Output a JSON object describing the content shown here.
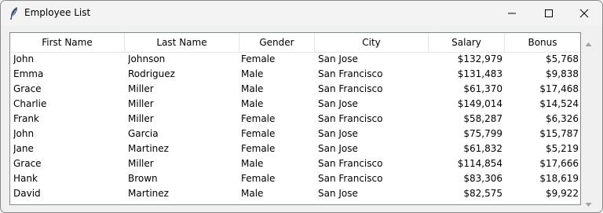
{
  "window": {
    "title": "Employee List",
    "icon": "feather-icon"
  },
  "controls": {
    "minimize_icon": "minimize-icon",
    "maximize_icon": "maximize-icon",
    "close_icon": "close-icon"
  },
  "table": {
    "columns": [
      "First Name",
      "Last Name",
      "Gender",
      "City",
      "Salary",
      "Bonus"
    ],
    "rows": [
      [
        "John",
        "Johnson",
        "Female",
        "San Jose",
        "$132,979",
        "$5,768"
      ],
      [
        "Emma",
        "Rodriguez",
        "Male",
        "San Francisco",
        "$131,483",
        "$9,838"
      ],
      [
        "Grace",
        "Miller",
        "Male",
        "San Francisco",
        "$61,370",
        "$17,468"
      ],
      [
        "Charlie",
        "Miller",
        "Male",
        "San Jose",
        "$149,014",
        "$14,524"
      ],
      [
        "Frank",
        "Miller",
        "Female",
        "San Francisco",
        "$58,287",
        "$6,326"
      ],
      [
        "John",
        "Garcia",
        "Female",
        "San Jose",
        "$75,799",
        "$15,787"
      ],
      [
        "Jane",
        "Martinez",
        "Female",
        "San Jose",
        "$61,832",
        "$5,219"
      ],
      [
        "Grace",
        "Miller",
        "Male",
        "San Francisco",
        "$114,854",
        "$17,666"
      ],
      [
        "Hank",
        "Brown",
        "Female",
        "San Francisco",
        "$83,306",
        "$18,619"
      ],
      [
        "David",
        "Martinez",
        "Male",
        "San Jose",
        "$82,575",
        "$9,922"
      ]
    ]
  },
  "scrollbar": {
    "up_icon": "scroll-up-arrow-icon",
    "down_icon": "scroll-down-arrow-icon"
  }
}
